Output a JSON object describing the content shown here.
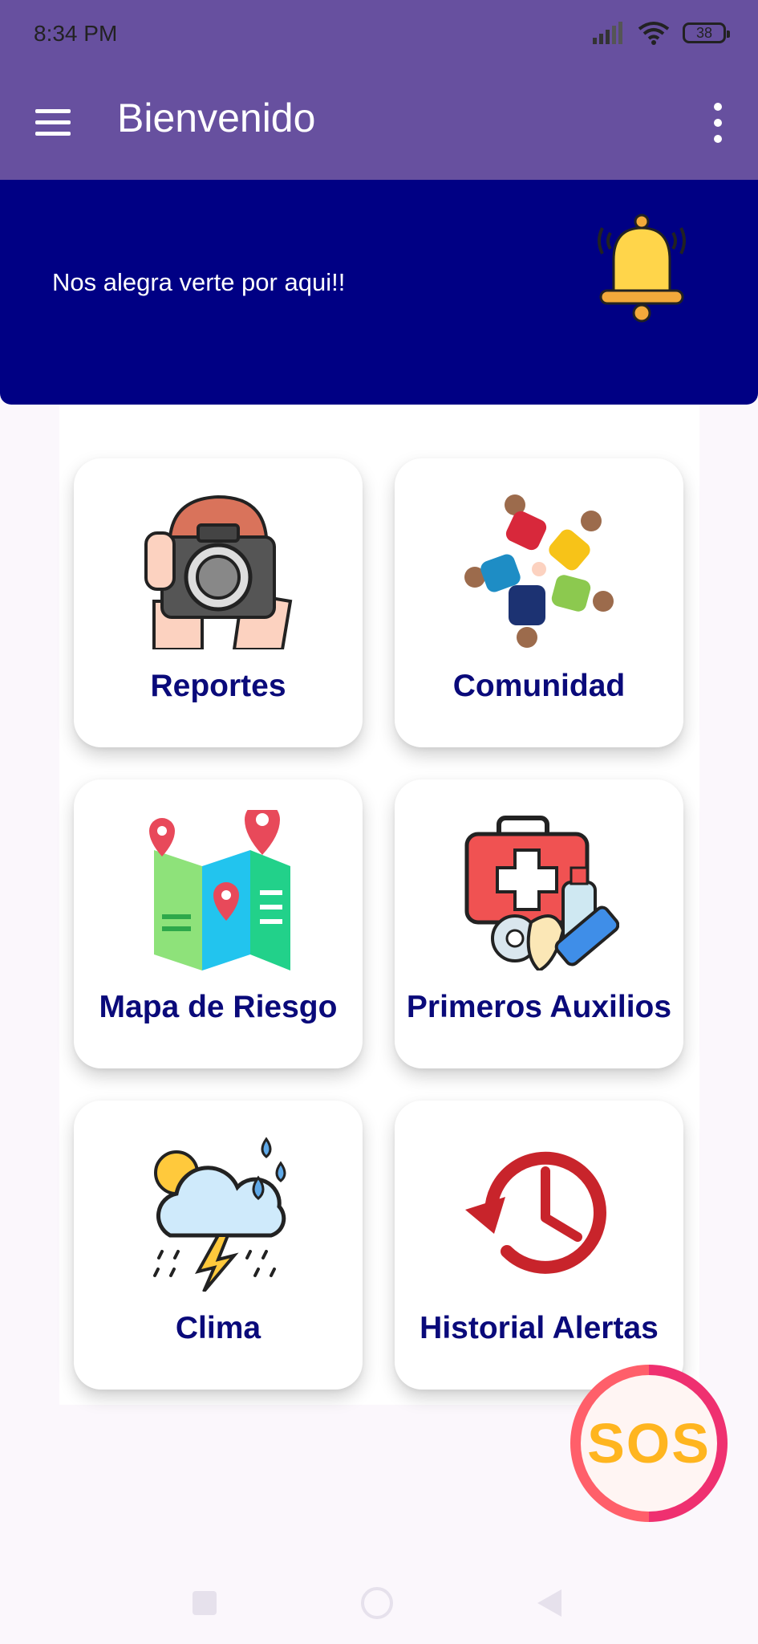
{
  "status": {
    "time": "8:34 PM",
    "battery": "38"
  },
  "appbar": {
    "title": "Bienvenido",
    "menu_icon": "hamburger-menu-icon",
    "overflow_icon": "more-vert-icon"
  },
  "banner": {
    "message": "Nos alegra verte por aqui!!",
    "icon": "bell-icon"
  },
  "cards": [
    {
      "label": "Reportes",
      "icon": "camera-photographer-icon"
    },
    {
      "label": "Comunidad",
      "icon": "community-people-icon"
    },
    {
      "label": "Mapa de Riesgo",
      "icon": "risk-map-icon"
    },
    {
      "label": "Primeros Auxilios",
      "icon": "first-aid-kit-icon"
    },
    {
      "label": "Clima",
      "icon": "weather-storm-icon"
    },
    {
      "label": "Historial Alertas",
      "icon": "history-clock-icon"
    }
  ],
  "sos": {
    "label": "SOS"
  },
  "colors": {
    "primary": "#67509f",
    "banner": "#000084",
    "card_label": "#0a0a7a",
    "sos_text": "#ffb51f"
  }
}
